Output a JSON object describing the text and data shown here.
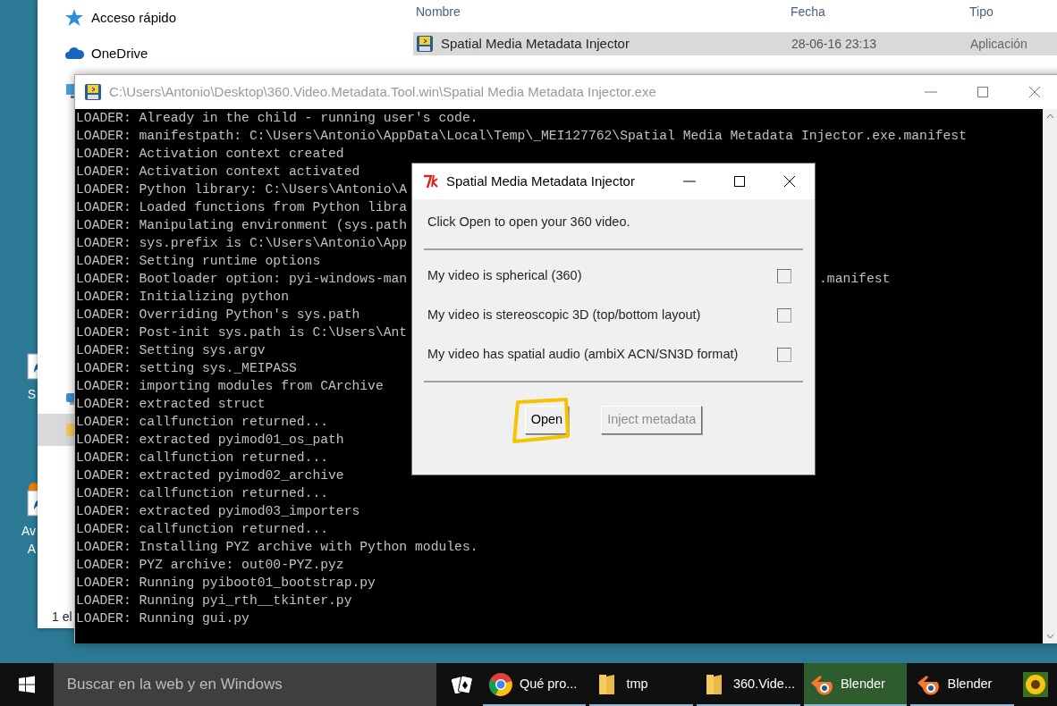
{
  "desktop": {
    "icons": [
      {
        "label_lines": [
          "S"
        ]
      },
      {
        "label_lines": [
          "Av",
          "A"
        ]
      }
    ]
  },
  "explorer": {
    "nav_top": [
      {
        "kind": "star",
        "label": "Acceso rápido",
        "selected": false
      },
      {
        "kind": "cloud",
        "label": "OneDrive",
        "selected": false
      },
      {
        "kind": "computer",
        "selected": false
      }
    ],
    "nav_bottom": [
      {
        "kind": "network",
        "selected": false
      },
      {
        "kind": "folder",
        "selected": true
      }
    ],
    "columns": [
      "Nombre",
      "Fecha",
      "Tipo"
    ],
    "rows": [
      {
        "name": "Spatial Media Metadata Injector",
        "date": "28-06-16 23:13",
        "type": "Aplicación",
        "selected": true
      }
    ],
    "status": "1 el"
  },
  "console": {
    "title": "C:\\Users\\Antonio\\Desktop\\360.Video.Metadata.Tool.win\\Spatial Media Metadata Injector.exe",
    "lines": [
      {
        "text": "LOADER: Already in the child - running user's code."
      },
      {
        "text": "LOADER: manifestpath: C:\\Users\\Antonio\\AppData\\Local\\Temp\\_MEI127762\\Spatial Media Metadata Injector.exe.manifest"
      },
      {
        "text": "LOADER: Activation context created"
      },
      {
        "text": "LOADER: Activation context activated"
      },
      {
        "text": "LOADER: Python library: C:\\Users\\Antonio\\A"
      },
      {
        "text": "LOADER: Loaded functions from Python libra"
      },
      {
        "text": "LOADER: Manipulating environment (sys.path"
      },
      {
        "text": "LOADER: sys.prefix is C:\\Users\\Antonio\\App"
      },
      {
        "text": "LOADER: Setting runtime options"
      },
      {
        "text": "LOADER: Bootloader option: pyi-windows-man",
        "tail": ".manifest"
      },
      {
        "text": "LOADER: Initializing python"
      },
      {
        "text": "LOADER: Overriding Python's sys.path"
      },
      {
        "text": "LOADER: Post-init sys.path is C:\\Users\\Ant"
      },
      {
        "text": "LOADER: Setting sys.argv"
      },
      {
        "text": "LOADER: setting sys._MEIPASS"
      },
      {
        "text": "LOADER: importing modules from CArchive"
      },
      {
        "text": "LOADER: extracted struct"
      },
      {
        "text": "LOADER: callfunction returned..."
      },
      {
        "text": "LOADER: extracted pyimod01_os_path"
      },
      {
        "text": "LOADER: callfunction returned..."
      },
      {
        "text": "LOADER: extracted pyimod02_archive"
      },
      {
        "text": "LOADER: callfunction returned..."
      },
      {
        "text": "LOADER: extracted pyimod03_importers"
      },
      {
        "text": "LOADER: callfunction returned..."
      },
      {
        "text": "LOADER: Installing PYZ archive with Python modules."
      },
      {
        "text": "LOADER: PYZ archive: out00-PYZ.pyz"
      },
      {
        "text": "LOADER: Running pyiboot01_bootstrap.py"
      },
      {
        "text": "LOADER: Running pyi_rth__tkinter.py"
      },
      {
        "text": "LOADER: Running gui.py"
      }
    ]
  },
  "dialog": {
    "title": "Spatial Media Metadata Injector",
    "message": "Click Open to open your 360 video.",
    "options": [
      {
        "label": "My video is spherical (360)",
        "checked": false
      },
      {
        "label": "My video is stereoscopic 3D (top/bottom layout)",
        "checked": false
      },
      {
        "label": "My video has spatial audio (ambiX ACN/SN3D format)",
        "checked": false
      }
    ],
    "buttons": [
      {
        "label": "Open",
        "disabled": false,
        "highlighted": true
      },
      {
        "label": "Inject metadata",
        "disabled": true,
        "highlighted": false
      }
    ]
  },
  "taskbar": {
    "search_placeholder": "Buscar en la web y en Windows",
    "items": [
      {
        "kind": "cards",
        "active": false,
        "running": false
      },
      {
        "kind": "chrome",
        "label": "Qué pro...",
        "active": false,
        "running": true
      },
      {
        "kind": "folder",
        "label": "tmp",
        "active": false,
        "running": true
      },
      {
        "kind": "folder",
        "label": "360.Vide...",
        "active": false,
        "running": true
      },
      {
        "kind": "blender",
        "label": "Blender",
        "active": true,
        "running": true
      },
      {
        "kind": "blender",
        "label": "Blender",
        "active": false,
        "running": true
      },
      {
        "kind": "sunflower",
        "active": false,
        "running": false
      }
    ]
  }
}
